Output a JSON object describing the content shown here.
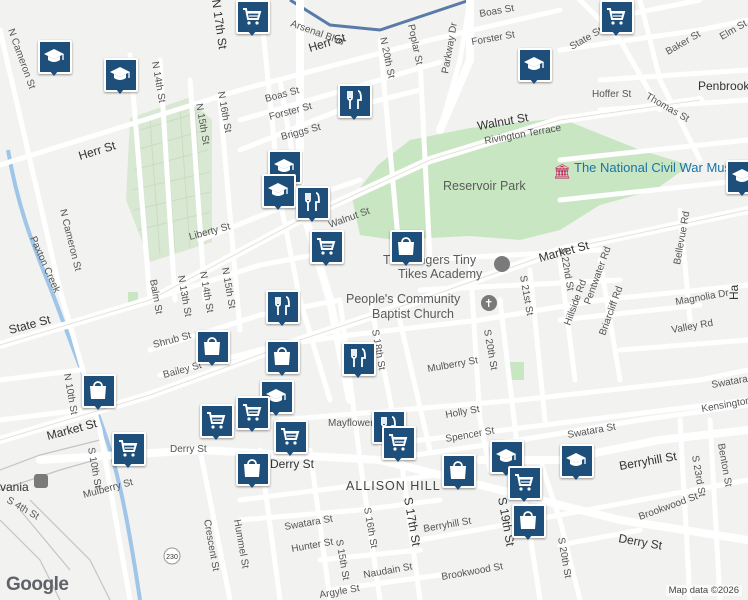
{
  "map": {
    "streets": {
      "arsenal": "Arsenal Blvd",
      "herr_w": "Herr St",
      "herr_e": "Herr St",
      "n_cameron_a": "N Cameron St",
      "n_cameron_b": "N Cameron St",
      "n_17th": "N 17th St",
      "n_20th": "N 20th St",
      "poplar": "Poplar St",
      "parkway": "Parkway Dr",
      "boas_e": "Boas St",
      "forster_e": "Forster St",
      "boas_w": "Boas St",
      "forster_w": "Forster St",
      "briggs": "Briggs St",
      "walnut": "Walnut St",
      "rivington": "Rivington Terrace",
      "hoffer": "Hoffer St",
      "thomas": "Thomas St",
      "state_e": "State St",
      "baker": "Baker St",
      "elm": "Elm St",
      "n_14th": "N 14th St",
      "n_16th": "N 16th St",
      "n_15th": "N 15th St",
      "liberty": "Liberty St",
      "walnut_short": "Walnut St",
      "n_15th_b": "N 15th St",
      "n_14th_b": "N 14th St",
      "n_13th": "N 13th St",
      "balm": "Balm St",
      "shrub": "Shrub St",
      "bailey": "Bailey St",
      "state_w": "State St",
      "paxton": "Paxton Creek",
      "market_w": "Market St",
      "market_e": "Market St",
      "n_10th": "N 10th St",
      "s_10th": "S 10th St",
      "s_4th": "S 4th St",
      "mulberry_w": "Mulberry St",
      "mulberry_e": "Mulberry St",
      "derry_w": "Derry St",
      "derry_mid": "Derry St",
      "derry_e": "Derry St",
      "crescent": "Crescent St",
      "hummel": "Hummel St",
      "swatara_w": "Swatara St",
      "hunter": "Hunter St",
      "s_15th": "S 15th St",
      "s_16th": "S 16th St",
      "s_17th": "S 17th St",
      "s_18th": "S 18th St",
      "s_20th": "S 20th St",
      "s_21st": "S 21st St",
      "s_22nd": "S 22nd St",
      "s_19th": "S 19th St",
      "s_20th_b": "S 20th St",
      "naudain": "Naudain St",
      "argyle": "Argyle St",
      "brookwood_w": "Brookwood St",
      "brookwood_e": "Brookwood St",
      "berryhill_w": "Berryhill St",
      "berryhill_e": "Berryhill St",
      "mayflower": "Mayflower St",
      "holly": "Holly St",
      "spencer": "Spencer St",
      "swatara_e": "Swatara St",
      "swatara_e2": "Swatara St",
      "kensington": "Kensington",
      "hillside": "Hillside Rd",
      "pentwater": "Pentwater Rd",
      "briarcliff": "Briarcliff Rd",
      "bellevue": "Bellevue Rd",
      "magnolia": "Magnolia Dr",
      "valley": "Valley Rd",
      "benton": "Benton St",
      "s_23rd": "S 23rd St",
      "route_230": "230"
    },
    "places": {
      "museum": "The National Civil War Museum",
      "reservoir": "Reservoir Park",
      "academy_line1": "The Fingers Tiny",
      "academy_line2": "Tikes Academy",
      "church_line1": "People's Community",
      "church_line2": "Baptist Church",
      "allison_hill": "ALLISON HILL",
      "penbrook": "Penbrook",
      "harrisburg_partial": "vania",
      "ha_partial": "Ha"
    },
    "attribution": "Map data ©2026",
    "google_logo": "Google"
  },
  "markers": [
    {
      "type": "grocery",
      "icon": "cart-icon"
    },
    {
      "type": "school",
      "icon": "graduation-cap-icon"
    },
    {
      "type": "school",
      "icon": "graduation-cap-icon"
    },
    {
      "type": "school",
      "icon": "graduation-cap-icon"
    },
    {
      "type": "grocery",
      "icon": "cart-icon"
    },
    {
      "type": "restaurant",
      "icon": "fork-knife-icon"
    },
    {
      "type": "school",
      "icon": "graduation-cap-icon"
    },
    {
      "type": "school",
      "icon": "graduation-cap-icon"
    },
    {
      "type": "restaurant",
      "icon": "fork-knife-icon"
    },
    {
      "type": "grocery",
      "icon": "cart-icon"
    },
    {
      "type": "shopping",
      "icon": "shopping-bag-icon"
    },
    {
      "type": "restaurant",
      "icon": "fork-knife-icon"
    },
    {
      "type": "shopping",
      "icon": "shopping-bag-icon"
    },
    {
      "type": "shopping",
      "icon": "shopping-bag-icon"
    },
    {
      "type": "restaurant",
      "icon": "fork-knife-icon"
    },
    {
      "type": "school",
      "icon": "graduation-cap-icon"
    },
    {
      "type": "grocery",
      "icon": "cart-icon"
    },
    {
      "type": "grocery",
      "icon": "cart-icon"
    },
    {
      "type": "grocery",
      "icon": "cart-icon"
    },
    {
      "type": "shopping",
      "icon": "shopping-bag-icon"
    },
    {
      "type": "shopping",
      "icon": "shopping-bag-icon"
    },
    {
      "type": "grocery",
      "icon": "cart-icon"
    },
    {
      "type": "restaurant",
      "icon": "fork-knife-icon"
    },
    {
      "type": "grocery",
      "icon": "cart-icon"
    },
    {
      "type": "shopping",
      "icon": "shopping-bag-icon"
    },
    {
      "type": "school",
      "icon": "graduation-cap-icon"
    },
    {
      "type": "grocery",
      "icon": "cart-icon"
    },
    {
      "type": "shopping",
      "icon": "shopping-bag-icon"
    },
    {
      "type": "school",
      "icon": "graduation-cap-icon"
    },
    {
      "type": "school",
      "icon": "graduation-cap-icon"
    }
  ],
  "colors": {
    "marker_fill": "#1d4f7a",
    "park": "#c8e6c2",
    "water": "#9fc5e8",
    "road": "#ffffff",
    "highway": "#5a7aa8"
  }
}
